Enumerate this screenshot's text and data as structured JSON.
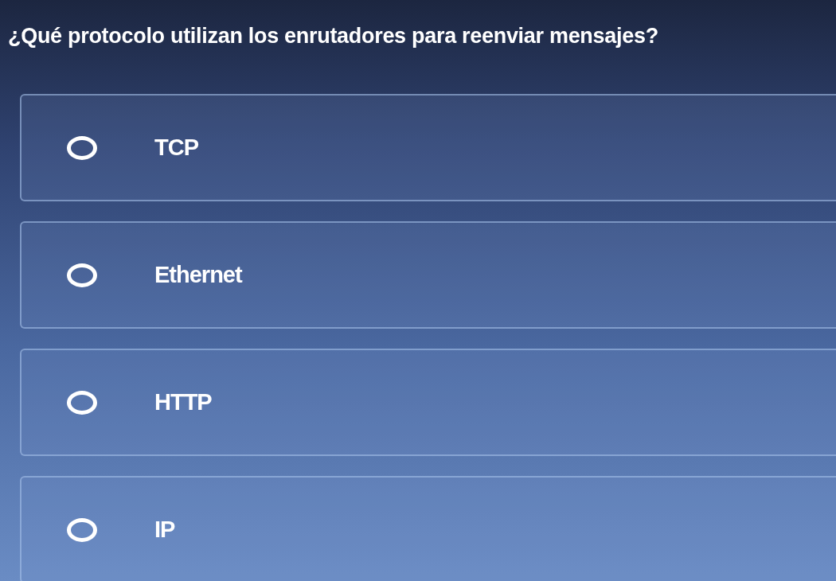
{
  "question": "¿Qué protocolo utilizan los enrutadores para reenviar mensajes?",
  "options": [
    {
      "label": "TCP",
      "selected": false
    },
    {
      "label": "Ethernet",
      "selected": false
    },
    {
      "label": "HTTP",
      "selected": false
    },
    {
      "label": "IP",
      "selected": false
    }
  ]
}
